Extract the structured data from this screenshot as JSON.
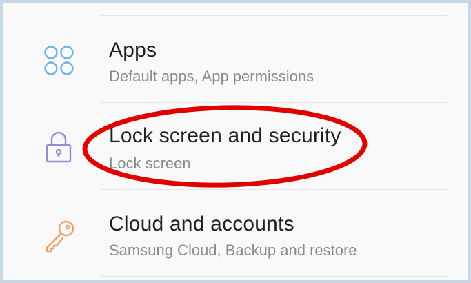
{
  "settings": {
    "items": [
      {
        "title": "Apps",
        "subtitle": "Default apps, App permissions",
        "icon": "apps-grid-icon",
        "icon_color": "#6fb4e3"
      },
      {
        "title": "Lock screen and security",
        "subtitle": "Lock screen",
        "icon": "lock-icon",
        "icon_color": "#9a88d6"
      },
      {
        "title": "Cloud and accounts",
        "subtitle": "Samsung Cloud, Backup and restore",
        "icon": "key-icon",
        "icon_color": "#f2a06b"
      }
    ]
  },
  "annotation": {
    "color": "#e00000"
  }
}
